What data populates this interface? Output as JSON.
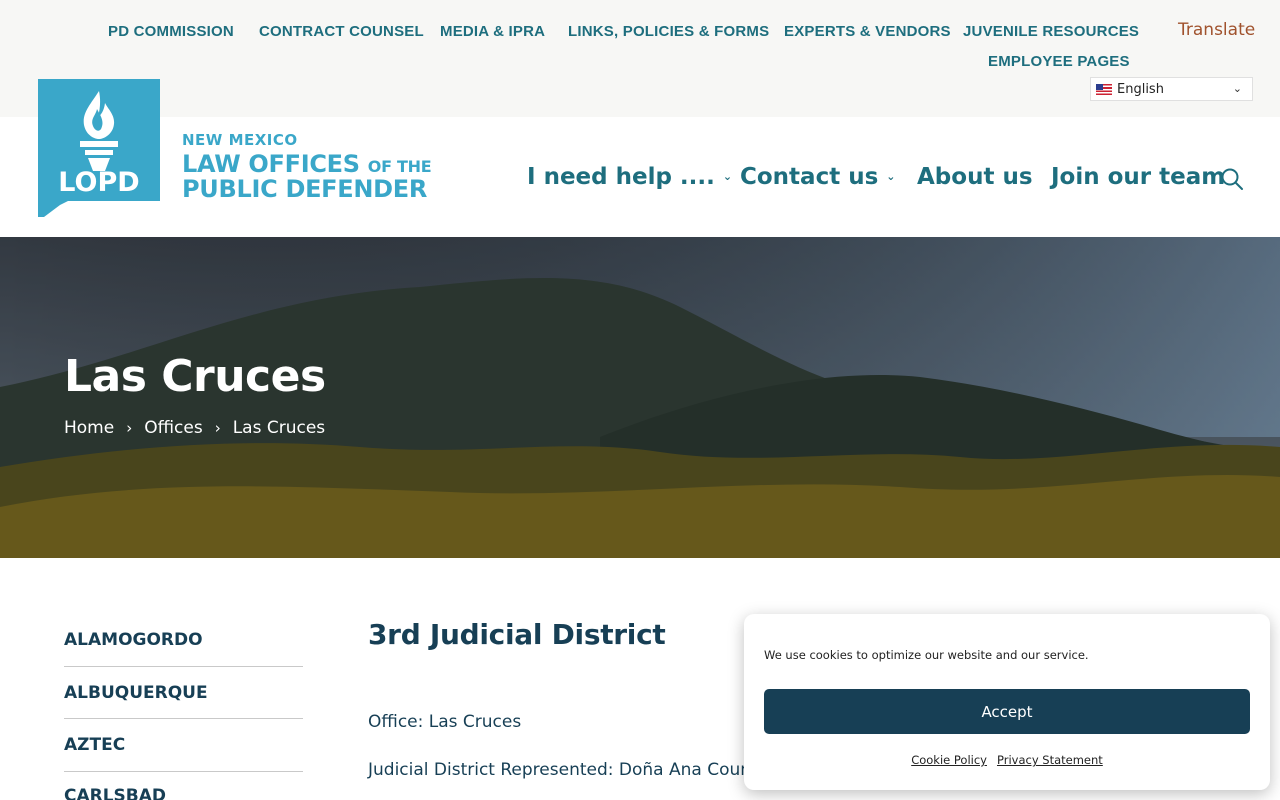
{
  "utility_nav": {
    "items": [
      "PD COMMISSION",
      "CONTRACT COUNSEL",
      "MEDIA & IPRA",
      "LINKS, POLICIES & FORMS",
      "EXPERTS & VENDORS",
      "JUVENILE RESOURCES",
      "EMPLOYEE PAGES"
    ]
  },
  "translate": {
    "label": "Translate",
    "selected_language": "English"
  },
  "logo": {
    "mark_text": "LOPD",
    "line1": "NEW MEXICO",
    "line2a": "LAW OFFICES",
    "line2b": "OF THE",
    "line3": "PUBLIC DEFENDER"
  },
  "main_nav": {
    "items": [
      "I need help ....",
      "Contact us",
      "About us",
      "Join our team"
    ]
  },
  "hero": {
    "title": "Las Cruces",
    "breadcrumb": [
      "Home",
      "Offices",
      "Las Cruces"
    ]
  },
  "sidebar": {
    "items": [
      "ALAMOGORDO",
      "ALBUQUERQUE",
      "AZTEC",
      "CARLSBAD"
    ]
  },
  "content": {
    "heading": "3rd Judicial District",
    "office_line": "Office: Las Cruces",
    "district_line": "Judicial District Represented: Doña Ana County"
  },
  "cookie_banner": {
    "message": "We use cookies to optimize our website and our service.",
    "accept_label": "Accept",
    "links": [
      "Cookie Policy",
      "Privacy Statement"
    ]
  },
  "colors": {
    "brand_teal": "#1e6e7e",
    "logo_blue": "#3aa7c9",
    "navy": "#173f55",
    "translate_brown": "#a0522d"
  }
}
